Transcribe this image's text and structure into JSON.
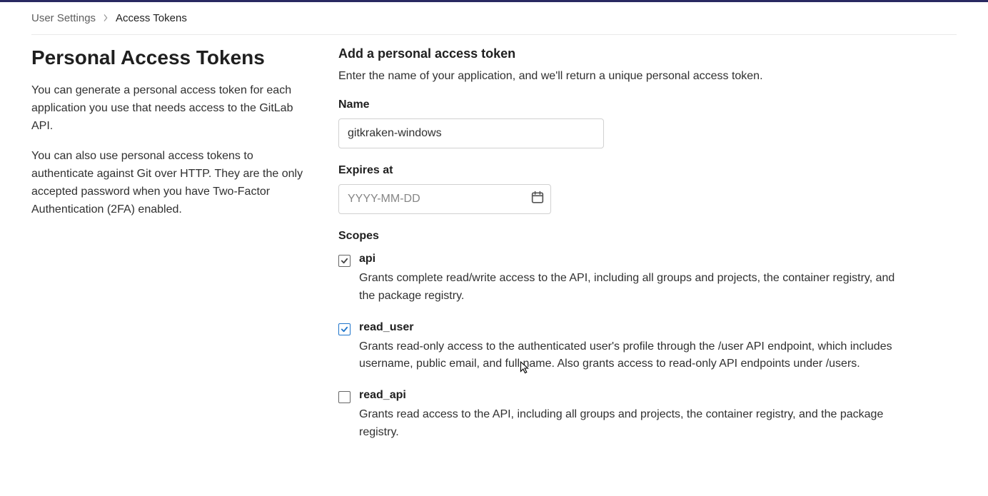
{
  "breadcrumb": {
    "parent": "User Settings",
    "current": "Access Tokens"
  },
  "left": {
    "title": "Personal Access Tokens",
    "para1": "You can generate a personal access token for each application you use that needs access to the GitLab API.",
    "para2": "You can also use personal access tokens to authenticate against Git over HTTP. They are the only accepted password when you have Two-Factor Authentication (2FA) enabled."
  },
  "form": {
    "heading": "Add a personal access token",
    "desc": "Enter the name of your application, and we'll return a unique personal access token.",
    "name_label": "Name",
    "name_value": "gitkraken-windows",
    "expires_label": "Expires at",
    "expires_placeholder": "YYYY-MM-DD",
    "scopes_label": "Scopes"
  },
  "scopes": [
    {
      "id": "api",
      "label": "api",
      "checked": true,
      "style": "gray",
      "desc": "Grants complete read/write access to the API, including all groups and projects, the container registry, and the package registry."
    },
    {
      "id": "read_user",
      "label": "read_user",
      "checked": true,
      "style": "blue",
      "desc": "Grants read-only access to the authenticated user's profile through the /user API endpoint, which includes username, public email, and full name. Also grants access to read-only API endpoints under /users."
    },
    {
      "id": "read_api",
      "label": "read_api",
      "checked": false,
      "style": "gray",
      "desc": "Grants read access to the API, including all groups and projects, the container registry, and the package registry."
    }
  ]
}
